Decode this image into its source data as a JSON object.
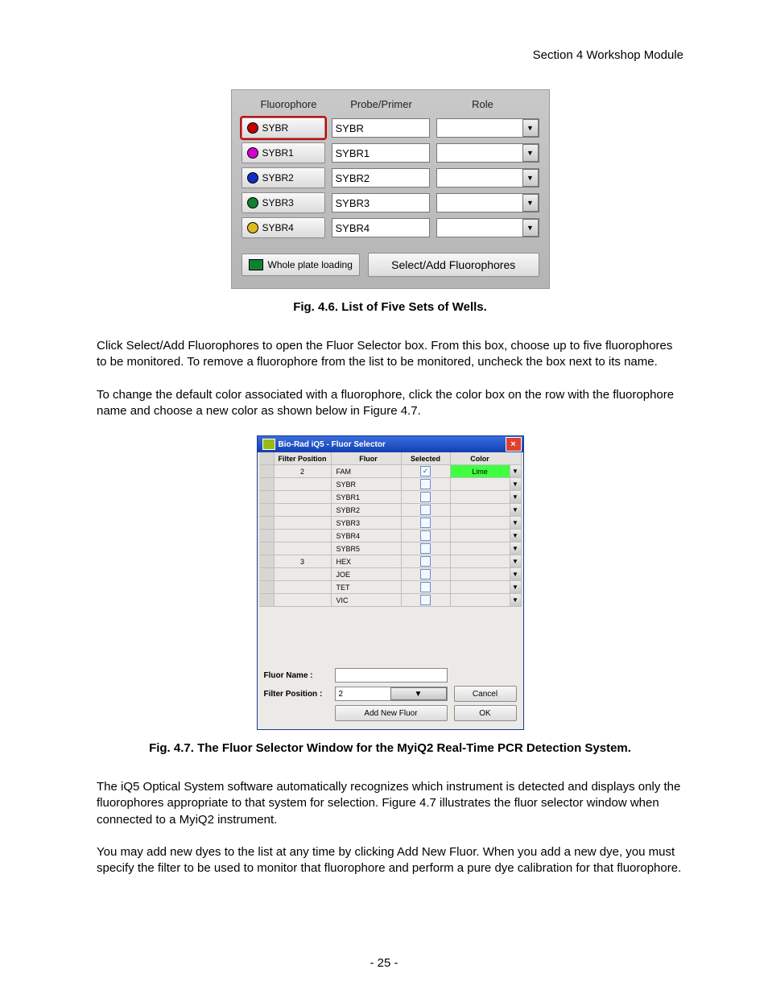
{
  "section_header": "Section 4 Workshop Module",
  "page_number": "- 25 -",
  "fig46": {
    "caption": "Fig. 4.6. List of Five Sets of Wells.",
    "headers": {
      "fluorophore": "Fluorophore",
      "probe": "Probe/Primer",
      "role": "Role"
    },
    "rows": [
      {
        "name": "SYBR",
        "probe": "SYBR",
        "color": "#c00000",
        "selected": true
      },
      {
        "name": "SYBR1",
        "probe": "SYBR1",
        "color": "#d000d0",
        "selected": false
      },
      {
        "name": "SYBR2",
        "probe": "SYBR2",
        "color": "#1030c0",
        "selected": false
      },
      {
        "name": "SYBR3",
        "probe": "SYBR3",
        "color": "#108030",
        "selected": false
      },
      {
        "name": "SYBR4",
        "probe": "SYBR4",
        "color": "#ddbb20",
        "selected": false
      }
    ],
    "whole_plate_color": "#108030",
    "whole_plate_label": "Whole plate loading",
    "select_add_label": "Select/Add Fluorophores"
  },
  "para1": "Click Select/Add Fluorophores to open the Fluor Selector box. From this box, choose up to five fluorophores to be monitored. To remove a fluorophore from the list to be monitored, uncheck the box next to its name.",
  "para2": "To change the default color associated with a fluorophore, click the color box on the row with the fluorophore name and choose a new color as shown below in Figure 4.7.",
  "fig47": {
    "caption": "Fig. 4.7. The Fluor Selector Window for the MyiQ2 Real-Time PCR Detection System.",
    "title": "Bio-Rad iQ5 - Fluor Selector",
    "headers": {
      "filter_position": "Filter Position",
      "fluor": "Fluor",
      "selected": "Selected",
      "color": "Color"
    },
    "rows": [
      {
        "filter_position": "2",
        "fluor": "FAM",
        "checked": true,
        "color_label": "Lime",
        "color_value": "#40ff40"
      },
      {
        "filter_position": "",
        "fluor": "SYBR",
        "checked": false,
        "color_label": "",
        "color_value": ""
      },
      {
        "filter_position": "",
        "fluor": "SYBR1",
        "checked": false,
        "color_label": "",
        "color_value": ""
      },
      {
        "filter_position": "",
        "fluor": "SYBR2",
        "checked": false,
        "color_label": "",
        "color_value": ""
      },
      {
        "filter_position": "",
        "fluor": "SYBR3",
        "checked": false,
        "color_label": "",
        "color_value": ""
      },
      {
        "filter_position": "",
        "fluor": "SYBR4",
        "checked": false,
        "color_label": "",
        "color_value": ""
      },
      {
        "filter_position": "",
        "fluor": "SYBR5",
        "checked": false,
        "color_label": "",
        "color_value": ""
      },
      {
        "filter_position": "3",
        "fluor": "HEX",
        "checked": false,
        "color_label": "",
        "color_value": ""
      },
      {
        "filter_position": "",
        "fluor": "JOE",
        "checked": false,
        "color_label": "",
        "color_value": ""
      },
      {
        "filter_position": "",
        "fluor": "TET",
        "checked": false,
        "color_label": "",
        "color_value": ""
      },
      {
        "filter_position": "",
        "fluor": "VIC",
        "checked": false,
        "color_label": "",
        "color_value": ""
      }
    ],
    "fluor_name_label": "Fluor Name :",
    "filter_position_label": "Filter Position :",
    "filter_position_value": "2",
    "add_new_fluor": "Add New Fluor",
    "cancel": "Cancel",
    "ok": "OK"
  },
  "para3": "The iQ5 Optical System software automatically recognizes which instrument is detected and displays only the fluorophores appropriate to that system for selection. Figure 4.7 illustrates the fluor selector window when connected to a MyiQ2 instrument.",
  "para4": "You may add new dyes to the list at any time by clicking Add New Fluor. When you add a new dye, you must specify the filter to be used to monitor that fluorophore and perform a pure dye calibration for that fluorophore."
}
